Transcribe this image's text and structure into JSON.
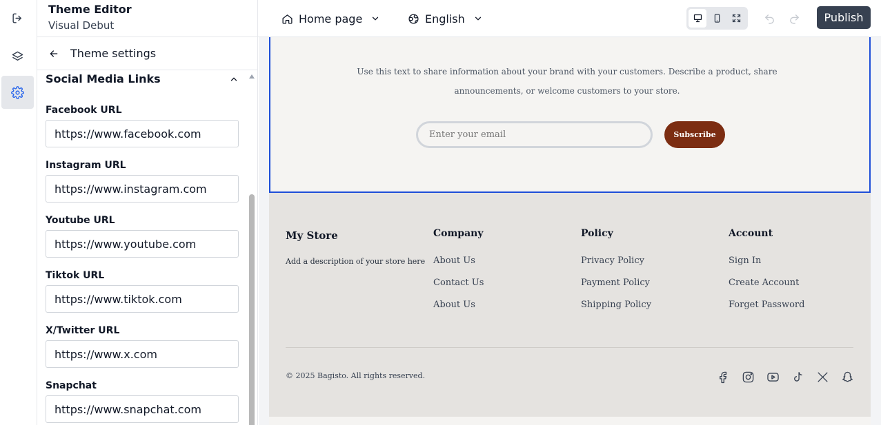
{
  "header": {
    "title": "Theme Editor",
    "subtitle": "Visual Debut",
    "page_select": "Home page",
    "language_select": "English",
    "publish_label": "Publish"
  },
  "panel": {
    "back_label": "Theme settings",
    "section_title": "Social Media Links",
    "fields": [
      {
        "label": "Facebook URL",
        "value": "https://www.facebook.com"
      },
      {
        "label": "Instagram URL",
        "value": "https://www.instagram.com"
      },
      {
        "label": "Youtube URL",
        "value": "https://www.youtube.com"
      },
      {
        "label": "Tiktok URL",
        "value": "https://www.tiktok.com"
      },
      {
        "label": "X/Twitter URL",
        "value": "https://www.x.com"
      },
      {
        "label": "Snapchat",
        "value": "https://www.snapchat.com"
      }
    ]
  },
  "preview": {
    "newsletter": {
      "text": "Use this text to share information about your brand with your customers. Describe a product, share announcements, or welcome customers to your store.",
      "email_placeholder": "Enter your email",
      "subscribe_label": "Subscribe",
      "accent_color": "#7c2d12"
    },
    "footer": {
      "store_title": "My Store",
      "store_description": "Add a description of your store here",
      "columns": [
        {
          "title": "Company",
          "links": [
            "About Us",
            "Contact Us",
            "About Us"
          ]
        },
        {
          "title": "Policy",
          "links": [
            "Privacy Policy",
            "Payment Policy",
            "Shipping Policy"
          ]
        },
        {
          "title": "Account",
          "links": [
            "Sign In",
            "Create Account",
            "Forget Password"
          ]
        }
      ],
      "copyright": "© 2025 Bagisto. All rights reserved.",
      "social_icons": [
        "facebook-icon",
        "instagram-icon",
        "youtube-icon",
        "tiktok-icon",
        "x-icon",
        "snapchat-icon"
      ]
    }
  },
  "colors": {
    "publish_bg": "#374151",
    "selection_border": "#1d4ed8"
  }
}
